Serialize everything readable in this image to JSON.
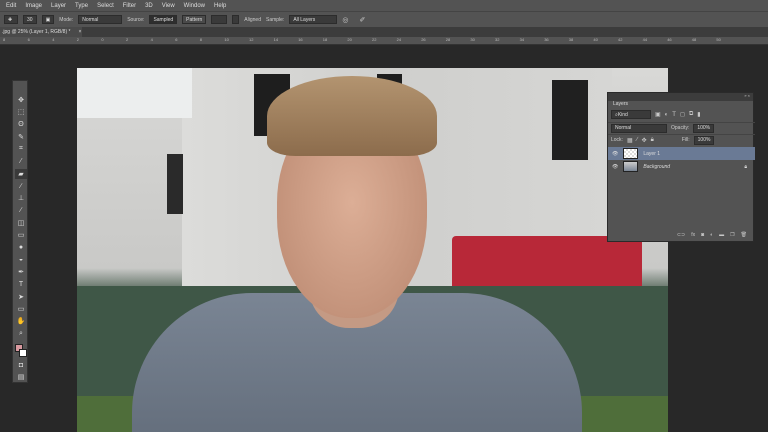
{
  "menu": [
    "Edit",
    "Image",
    "Layer",
    "Type",
    "Select",
    "Filter",
    "3D",
    "View",
    "Window",
    "Help"
  ],
  "options": {
    "brush_size": "30",
    "mode_label": "Mode:",
    "mode_value": "Normal",
    "source_label": "Source:",
    "source_sampled": "Sampled",
    "source_pattern": "Pattern",
    "aligned_label": "Aligned",
    "sample_label": "Sample:",
    "sample_value": "All Layers"
  },
  "document_tab": {
    "title": ".jpg @ 25% (Layer 1, RGB/8) *",
    "close": "×"
  },
  "ruler_ticks": [
    "8",
    "6",
    "4",
    "2",
    "0",
    "2",
    "4",
    "6",
    "8",
    "10",
    "12",
    "14",
    "16",
    "18",
    "20",
    "22",
    "24",
    "26",
    "28",
    "30",
    "32",
    "34",
    "36",
    "38",
    "40",
    "42",
    "44",
    "46",
    "48",
    "50"
  ],
  "tools": [
    {
      "name": "move",
      "g": "✥"
    },
    {
      "name": "marquee",
      "g": "⬚"
    },
    {
      "name": "lasso",
      "g": "ʘ"
    },
    {
      "name": "quick-select",
      "g": "✎"
    },
    {
      "name": "crop",
      "g": "⌗"
    },
    {
      "name": "eyedropper",
      "g": "⁄"
    },
    {
      "name": "healing-brush",
      "g": "▰",
      "active": true
    },
    {
      "name": "brush",
      "g": "∕"
    },
    {
      "name": "clone-stamp",
      "g": "⊥"
    },
    {
      "name": "history-brush",
      "g": "∕"
    },
    {
      "name": "eraser",
      "g": "◫"
    },
    {
      "name": "gradient",
      "g": "▭"
    },
    {
      "name": "blur",
      "g": "●"
    },
    {
      "name": "dodge",
      "g": "◒"
    },
    {
      "name": "pen",
      "g": "✒"
    },
    {
      "name": "type",
      "g": "T"
    },
    {
      "name": "path-select",
      "g": "➤"
    },
    {
      "name": "rectangle",
      "g": "▭"
    },
    {
      "name": "hand",
      "g": "✋"
    },
    {
      "name": "zoom",
      "g": "⌕"
    }
  ],
  "colors": {
    "foreground": "#d99aa0",
    "background": "#ffffff",
    "panel": "#535353",
    "selected_layer": "#6a7a95"
  },
  "layers_panel": {
    "title": "Layers",
    "filter_value": "Kind",
    "blend_mode": "Normal",
    "opacity_label": "Opacity:",
    "opacity_value": "100%",
    "lock_label": "Lock:",
    "fill_label": "Fill:",
    "fill_value": "100%",
    "layers": [
      {
        "name": "Layer 1",
        "selected": true,
        "visible": true
      },
      {
        "name": "Background",
        "selected": false,
        "visible": true,
        "locked": true
      }
    ]
  }
}
